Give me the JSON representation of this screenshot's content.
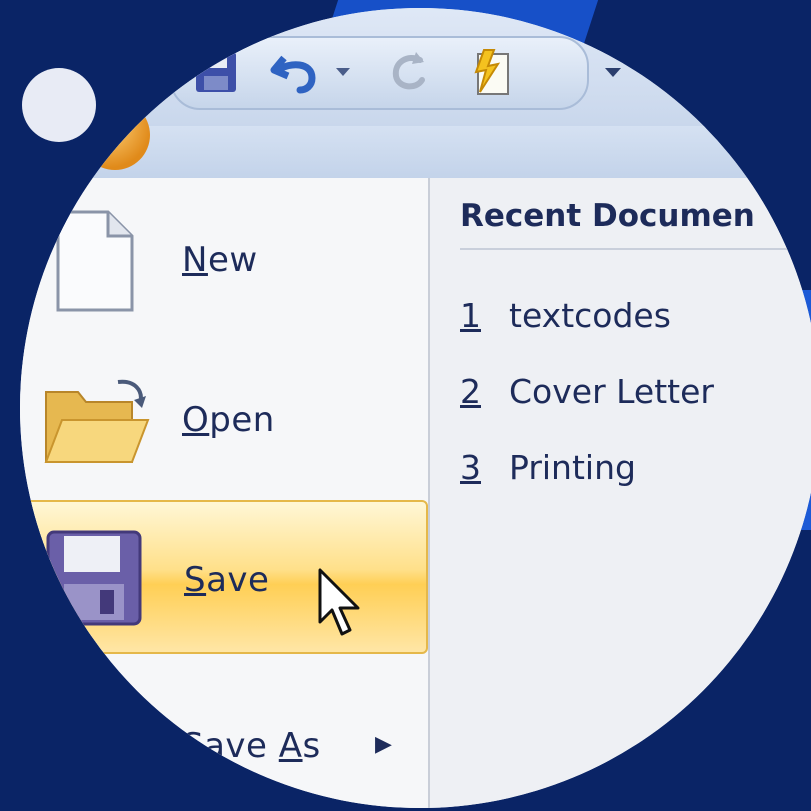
{
  "toolbar": {
    "icons": [
      "save-icon",
      "undo-icon",
      "undo-dropdown-icon",
      "redo-icon",
      "spelling-icon",
      "customize-toolbar-icon"
    ]
  },
  "menu": {
    "items": [
      {
        "mnemonic": "N",
        "rest": "ew",
        "icon": "new-document-icon"
      },
      {
        "mnemonic": "O",
        "rest": "pen",
        "icon": "open-folder-icon"
      },
      {
        "mnemonic": "S",
        "rest": "ave",
        "icon": "save-disk-icon",
        "selected": true
      },
      {
        "prefix": "Save ",
        "mnemonic": "A",
        "rest": "s",
        "icon": "save-as-icon",
        "has_submenu": true
      }
    ]
  },
  "recent": {
    "title": "Recent Documen",
    "items": [
      {
        "num": "1",
        "name": "textcodes"
      },
      {
        "num": "2",
        "name": "Cover Letter"
      },
      {
        "num": "3",
        "name": "Printing"
      }
    ]
  },
  "colors": {
    "background": "#0a2466",
    "accent_blue": "#1750c8",
    "selection_gold": "#ffcf55",
    "text_navy": "#1d2b5a"
  }
}
